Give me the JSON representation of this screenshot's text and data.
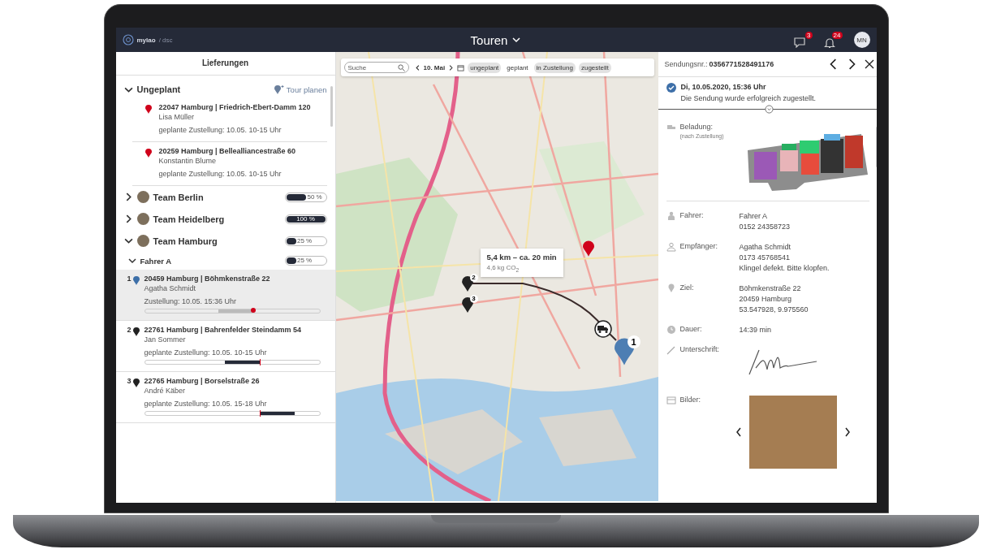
{
  "header": {
    "logo": "mylao",
    "logo_suffix": "/ dsc",
    "title": "Touren",
    "message_badge": "3",
    "alert_badge": "24",
    "avatar": "MN"
  },
  "sidebar": {
    "title": "Lieferungen",
    "unplanned": {
      "label": "Ungeplant",
      "expanded": true,
      "action": "Tour planen",
      "items": [
        {
          "address": "22047 Hamburg | Friedrich-Ebert-Damm 120",
          "name": "Lisa Müller",
          "delivery": "geplante Zustellung: 10.05. 10-15 Uhr"
        },
        {
          "address": "20259 Hamburg | Bellealliancestraße 60",
          "name": "Konstantin Blume",
          "delivery": "geplante Zustellung: 10.05. 10-15 Uhr"
        }
      ]
    },
    "teams": [
      {
        "name": "Team Berlin",
        "expanded": false,
        "level": 0.5,
        "reading": "50 %"
      },
      {
        "name": "Team Heidelberg",
        "expanded": false,
        "level": 1,
        "reading": "100 %"
      },
      {
        "name": "Team Hamburg",
        "expanded": true,
        "level": 0.25,
        "reading": "25 %",
        "children": [
          {
            "name": "Fahrer A",
            "expanded": true,
            "level": 0.25,
            "reading": "25 %",
            "stops": [
              {
                "number": "1",
                "selected": true,
                "delivered": true,
                "kind": "before",
                "level": 0.62,
                "address": "20459 Hamburg | Böhmkenstraße 22",
                "name": "Agatha Schmidt",
                "delivery": "Zustellung:   10.05. 15:36 Uhr"
              },
              {
                "number": "2",
                "selected": false,
                "delivered": false,
                "kind": "before",
                "level": 0.66,
                "address": "22761 Hamburg | Bahrenfelder Steindamm 54",
                "name": "Jan Sommer",
                "delivery": "geplante Zustellung: 10.05. 10-15 Uhr"
              },
              {
                "number": "3",
                "selected": false,
                "delivered": false,
                "kind": "after",
                "level": 0.66,
                "address": "22765 Hamburg | Borselstraße 26",
                "name": "André Käber",
                "delivery": "geplante Zustellung: 10.05. 15-18 Uhr"
              }
            ]
          }
        ]
      }
    ]
  },
  "map": {
    "search": {
      "placeholder": "Suche"
    },
    "date": "10. Mai",
    "filters": [
      {
        "label": "ungeplant",
        "selected": true
      },
      {
        "label": "geplant",
        "selected": false
      },
      {
        "label": "in Zustellung",
        "selected": true
      },
      {
        "label": "zugestellt",
        "selected": true
      }
    ],
    "route_info": {
      "distance": "5,4 km – ca. 20 min",
      "co2": "4,6 kg CO$_{2}$"
    },
    "markers": [
      {
        "kind": "stop",
        "label": "2"
      },
      {
        "kind": "stop",
        "label": "3"
      },
      {
        "kind": "unplanned"
      },
      {
        "kind": "vehicle"
      },
      {
        "kind": "selected",
        "label": "1"
      }
    ]
  },
  "detail": {
    "number_label": "Sendungsnr.:",
    "number": "0356771528491176",
    "status": {
      "date": "Di, 10.05.2020, 15:36 Uhr",
      "message": "Die Sendung wurde erfolgreich zugestellt."
    },
    "rows": [
      {
        "kind": "loading",
        "label": "Beladung:",
        "note": "(nach Zustellung)"
      },
      {
        "kind": "driver",
        "label": "Fahrer:",
        "lines": [
          "Fahrer A",
          "0152 24358723"
        ]
      },
      {
        "kind": "recipient",
        "label": "Empfänger:",
        "lines": [
          "Agatha Schmidt",
          "0173 45768541",
          "Klingel defekt. Bitte klopfen."
        ]
      },
      {
        "kind": "destination",
        "label": "Ziel:",
        "lines": [
          "Böhmkenstraße 22",
          "20459 Hamburg",
          "53.547928, 9.975560"
        ]
      },
      {
        "kind": "duration",
        "label": "Dauer:",
        "lines": [
          "14:39 min"
        ]
      },
      {
        "kind": "signature",
        "label": "Unterschrift:"
      },
      {
        "kind": "images",
        "label": "Bilder:"
      }
    ]
  }
}
